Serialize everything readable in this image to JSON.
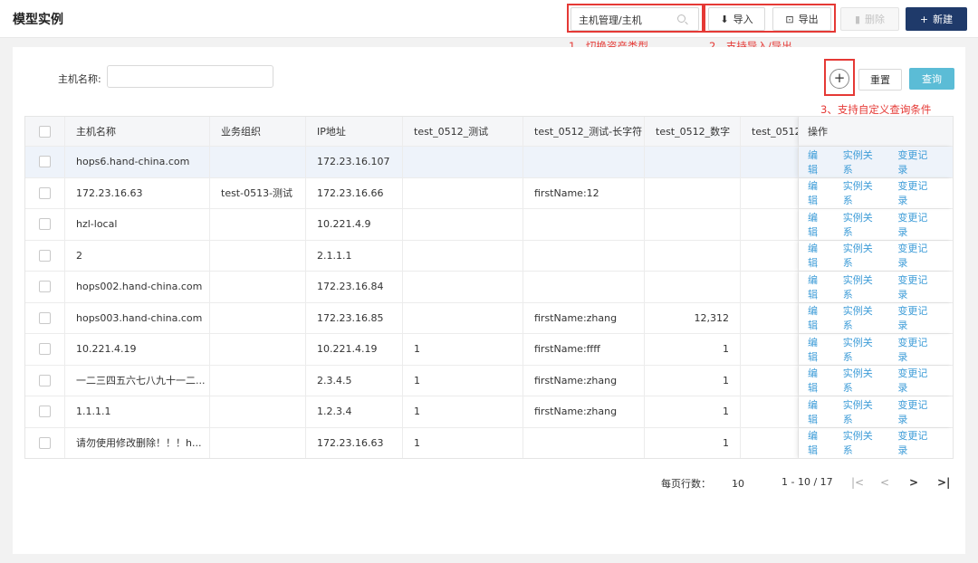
{
  "header": {
    "title": "模型实例",
    "type_select_value": "主机管理/主机",
    "import_label": "导入",
    "export_label": "导出",
    "delete_label": "删除",
    "new_label": "新建"
  },
  "annotations": {
    "a1": "1、切换资产类型",
    "a2": "2、支持导入/导出",
    "a3": "3、支持自定义查询条件"
  },
  "filter": {
    "label": "主机名称:",
    "value": "",
    "add_condition": "+",
    "reset_label": "重置",
    "query_label": "查询"
  },
  "table": {
    "columns": [
      "主机名称",
      "业务组织",
      "IP地址",
      "test_0512_测试",
      "test_0512_测试-长字符",
      "test_0512_数字",
      "test_0512_",
      "操作"
    ],
    "rows": [
      [
        "hops6.hand-china.com",
        "",
        "172.23.16.107",
        "",
        "",
        "",
        ""
      ],
      [
        "172.23.16.63",
        "test-0513-测试",
        "172.23.16.66",
        "",
        "firstName:12",
        "",
        ""
      ],
      [
        "hzl-local",
        "",
        "10.221.4.9",
        "",
        "",
        "",
        ""
      ],
      [
        "2",
        "",
        "2.1.1.1",
        "",
        "",
        "",
        ""
      ],
      [
        "hops002.hand-china.com",
        "",
        "172.23.16.84",
        "",
        "",
        "",
        ""
      ],
      [
        "hops003.hand-china.com",
        "",
        "172.23.16.85",
        "",
        "firstName:zhang",
        "12,312",
        ""
      ],
      [
        "10.221.4.19",
        "",
        "10.221.4.19",
        "1",
        "firstName:ffff",
        "1",
        ""
      ],
      [
        "一二三四五六七八九十一二...",
        "",
        "2.3.4.5",
        "1",
        "firstName:zhang",
        "1",
        ""
      ],
      [
        "1.1.1.1",
        "",
        "1.2.3.4",
        "1",
        "firstName:zhang",
        "1",
        ""
      ],
      [
        "请勿使用修改删除！！！h...",
        "",
        "172.23.16.63",
        "1",
        "",
        "1",
        ""
      ]
    ],
    "ops": [
      "编辑",
      "实例关系",
      "变更记录"
    ]
  },
  "pagination": {
    "page_size_label": "每页行数：",
    "page_size": "10",
    "range": "1 - 10 / 17",
    "first": "|<",
    "prev": "<",
    "next": ">",
    "last": ">|"
  },
  "colors": {
    "primary": "#1f3a6a",
    "query": "#5bbcd6",
    "link": "#3f9dd8",
    "annotation": "#e53935"
  }
}
